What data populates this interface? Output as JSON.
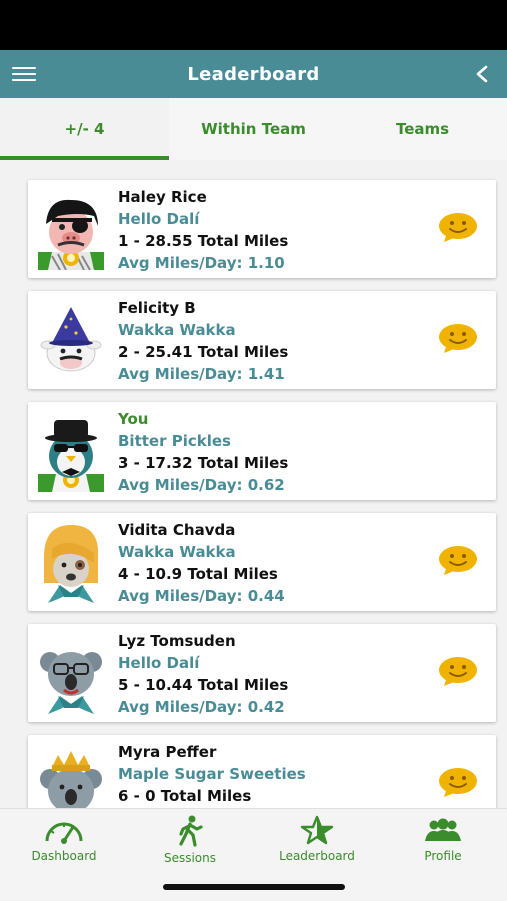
{
  "header": {
    "title": "Leaderboard"
  },
  "tabs": [
    {
      "label": "+/- 4",
      "active": true
    },
    {
      "label": "Within Team",
      "active": false
    },
    {
      "label": "Teams",
      "active": false
    }
  ],
  "entries": [
    {
      "name": "Haley Rice",
      "team": "Hello Dalí",
      "miles": "1 - 28.55 Total Miles",
      "avg": "Avg Miles/Day: 1.10",
      "avatar": "pirate-pig-avatar",
      "has_emoji": true
    },
    {
      "name": "Felicity B",
      "team": "Wakka Wakka",
      "miles": "2 - 25.41 Total Miles",
      "avg": "Avg Miles/Day: 1.41",
      "avatar": "wizard-cow-avatar",
      "has_emoji": true
    },
    {
      "name": "You",
      "team": "Bitter Pickles",
      "miles": "3 - 17.32 Total Miles",
      "avg": "Avg Miles/Day: 0.62",
      "avatar": "spy-penguin-avatar",
      "has_emoji": false
    },
    {
      "name": "Vidita Chavda",
      "team": "Wakka Wakka",
      "miles": "4 - 10.9 Total Miles",
      "avg": "Avg Miles/Day: 0.44",
      "avatar": "blonde-dog-avatar",
      "has_emoji": true
    },
    {
      "name": "Lyz Tomsuden",
      "team": "Hello Dalí",
      "miles": "5 - 10.44 Total Miles",
      "avg": "Avg Miles/Day: 0.42",
      "avatar": "koala-glasses-avatar",
      "has_emoji": true
    },
    {
      "name": "Myra Peffer",
      "team": "Maple Sugar Sweeties",
      "miles": "6 - 0 Total Miles",
      "avg": "",
      "avatar": "koala-crown-avatar",
      "has_emoji": true
    }
  ],
  "bottom_nav": [
    {
      "label": "Dashboard",
      "icon": "speedometer-icon"
    },
    {
      "label": "Sessions",
      "icon": "walking-icon"
    },
    {
      "label": "Leaderboard",
      "icon": "star-icon"
    },
    {
      "label": "Profile",
      "icon": "people-icon"
    }
  ],
  "colors": {
    "teal": "#4a8c96",
    "green": "#3a8c2c",
    "emoji": "#f0b400"
  }
}
